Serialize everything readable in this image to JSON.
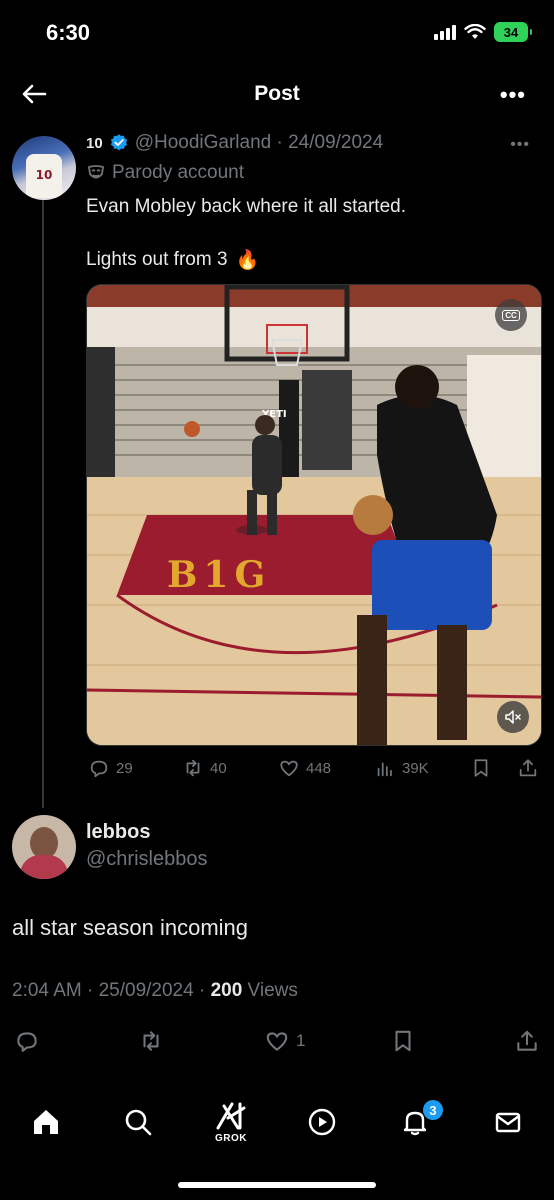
{
  "status_bar": {
    "time": "6:30",
    "battery": "34"
  },
  "nav": {
    "title": "Post"
  },
  "parent_tweet": {
    "name": "10",
    "handle_date": "@HoodiGarland · 24/09/2024",
    "parody_label": "Parody account",
    "text_line1": "Evan Mobley back where it all started.",
    "text_line2": "Lights out from 3",
    "emoji": "🔥",
    "stats": {
      "replies": "29",
      "reposts": "40",
      "likes": "448",
      "views": "39K"
    },
    "media_alt_text": "YETI"
  },
  "reply": {
    "name": "lebbos",
    "handle": "@chrislebbos",
    "text": "all star season incoming",
    "time": "2:04 AM · 25/09/2024 · ",
    "views_count": "200",
    "views_label": " Views",
    "likes": "1"
  },
  "tabbar": {
    "grok_label": "GROK",
    "notifications_badge": "3"
  },
  "colors": {
    "background": "#000000",
    "text_primary": "#e7e9ea",
    "text_secondary": "#71767b",
    "accent": "#1d9bf0",
    "battery": "#30d158"
  }
}
